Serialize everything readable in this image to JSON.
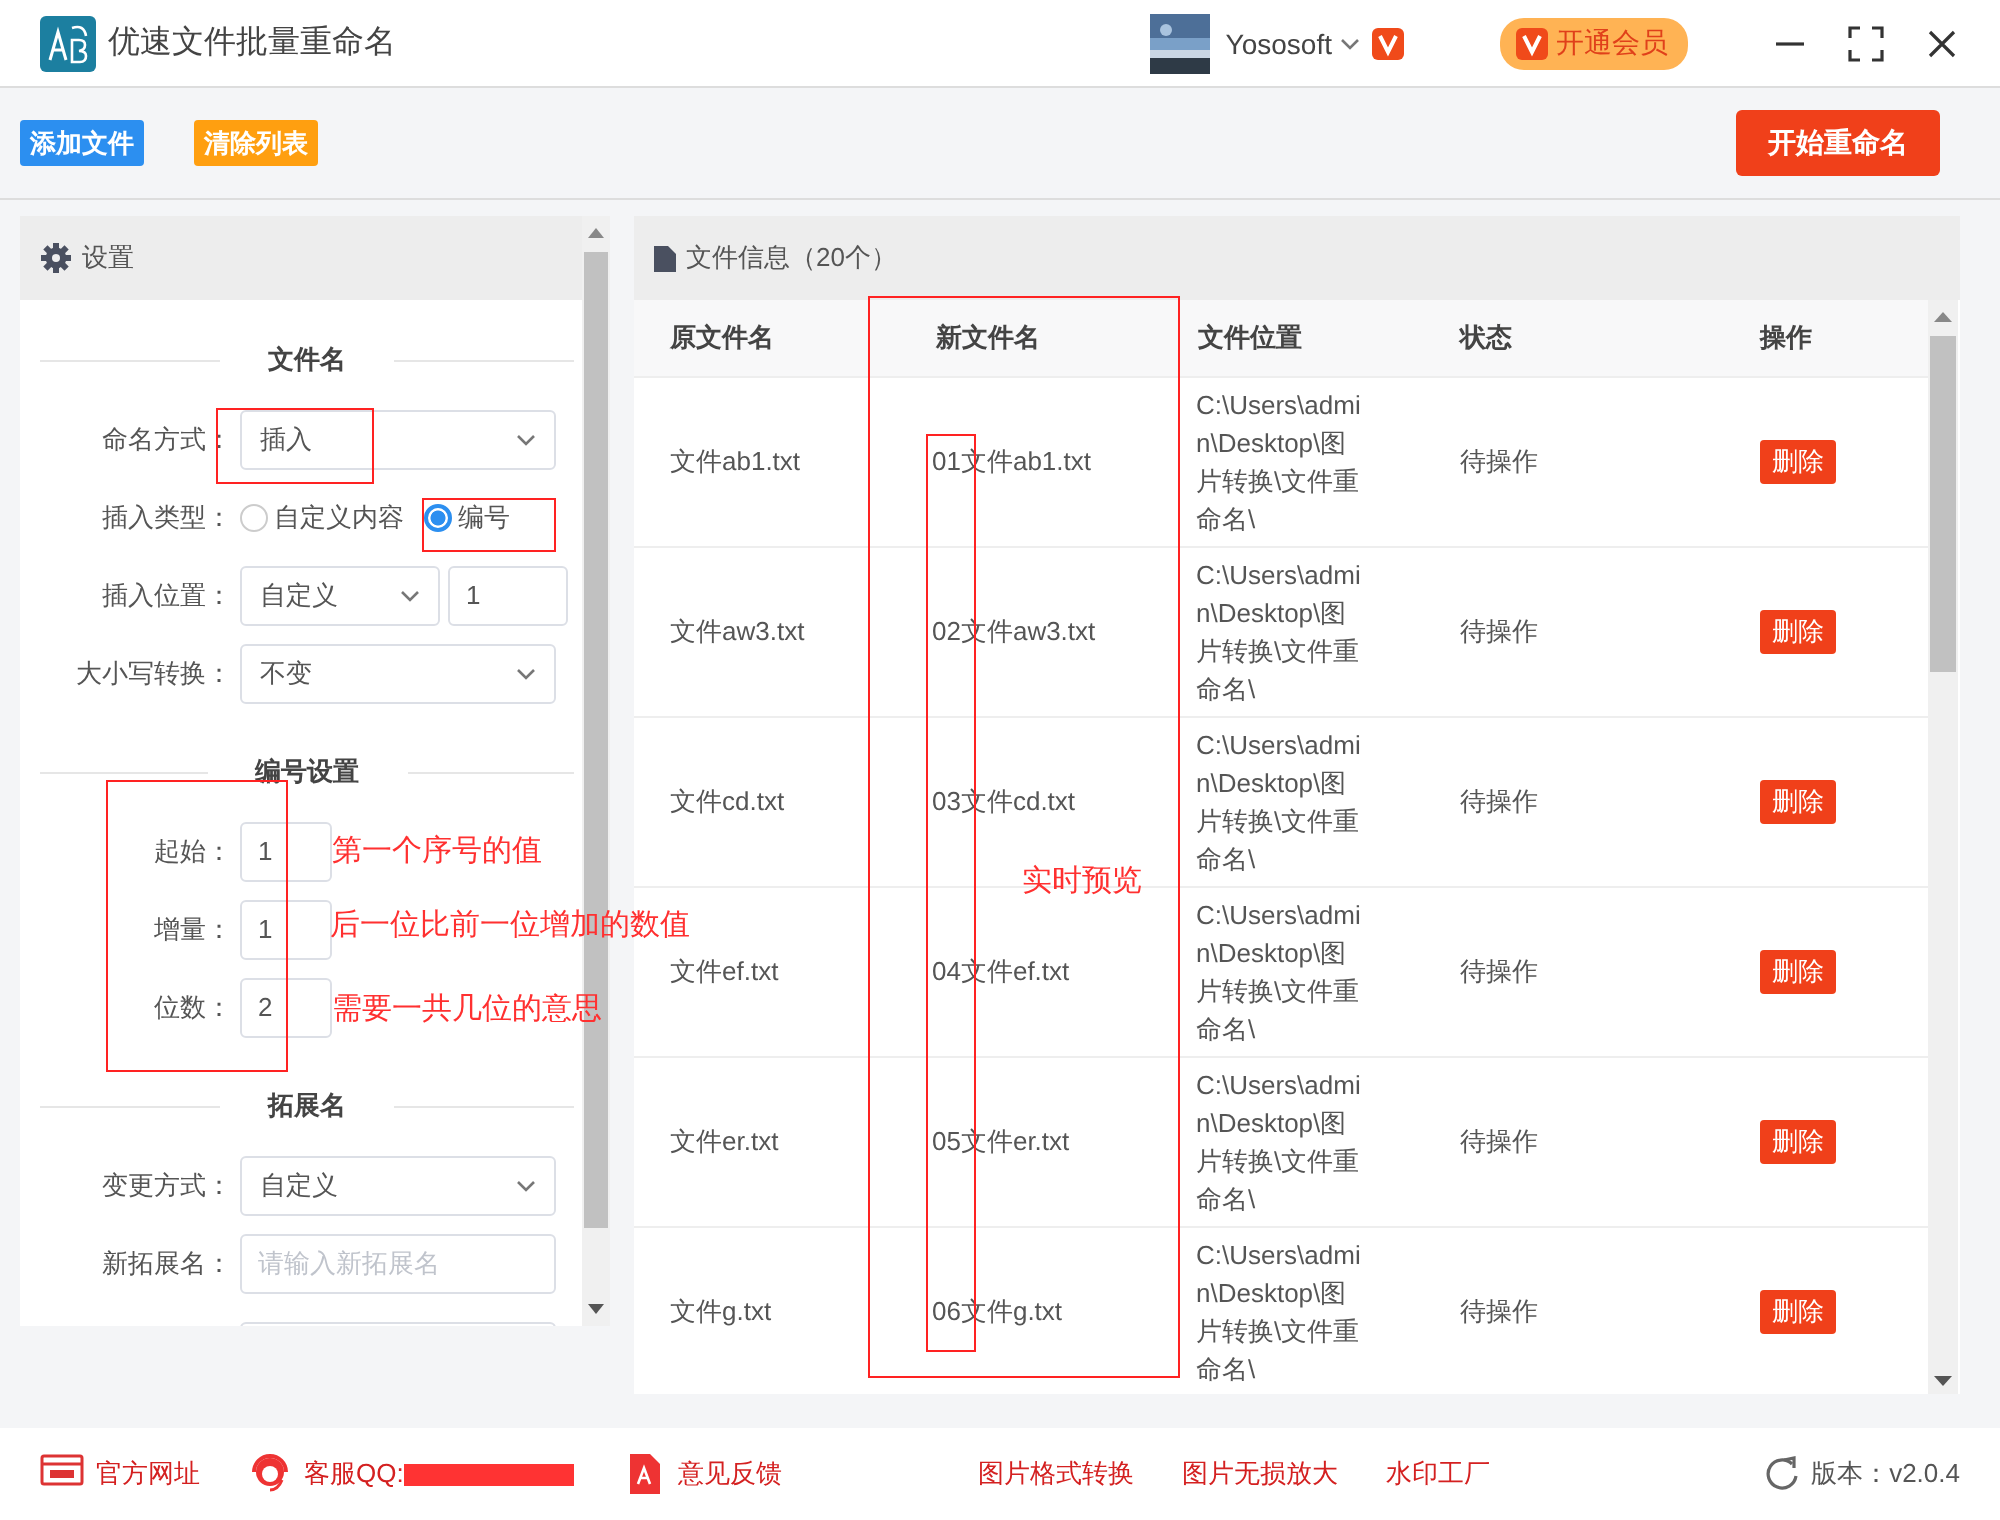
{
  "window": {
    "title": "优速文件批量重命名",
    "user": "Yososoft",
    "vip_button": "开通会员"
  },
  "toolbar": {
    "buttons": [
      {
        "label": "添加文件",
        "kind": "blue"
      },
      {
        "label": "清除列表",
        "kind": "orange"
      }
    ],
    "start_button": "开始重命名"
  },
  "settings": {
    "title": "设置",
    "sections": [
      {
        "title": "文件名",
        "rows": [
          {
            "kind": "select",
            "label": "命名方式：",
            "value": "插入"
          },
          {
            "kind": "radio",
            "label": "插入类型：",
            "options": [
              {
                "label": "自定义内容",
                "selected": false
              },
              {
                "label": "编号",
                "selected": true
              }
            ]
          },
          {
            "kind": "select-input",
            "label": "插入位置：",
            "value": "自定义",
            "input": "1"
          },
          {
            "kind": "select",
            "label": "大小写转换：",
            "value": "不变"
          }
        ]
      },
      {
        "title": "编号设置",
        "rows": [
          {
            "kind": "number",
            "label": "起始：",
            "value": "1"
          },
          {
            "kind": "number",
            "label": "增量：",
            "value": "1"
          },
          {
            "kind": "number",
            "label": "位数：",
            "value": "2"
          }
        ]
      },
      {
        "title": "拓展名",
        "rows": [
          {
            "kind": "select",
            "label": "变更方式：",
            "value": "自定义"
          },
          {
            "kind": "input",
            "label": "新拓展名：",
            "placeholder": "请输入新拓展名"
          }
        ]
      }
    ]
  },
  "files": {
    "title": "文件信息（20个）",
    "columns": [
      "原文件名",
      "新文件名",
      "文件位置",
      "状态",
      "操作"
    ],
    "rows": [
      {
        "original": "文件ab1.txt",
        "new": "01文件ab1.txt",
        "location": "C:\\Users\\admin\\Desktop\\图片转换\\文件重命名\\",
        "status": "待操作",
        "action": "删除"
      },
      {
        "original": "文件aw3.txt",
        "new": "02文件aw3.txt",
        "location": "C:\\Users\\admin\\Desktop\\图片转换\\文件重命名\\",
        "status": "待操作",
        "action": "删除"
      },
      {
        "original": "文件cd.txt",
        "new": "03文件cd.txt",
        "location": "C:\\Users\\admin\\Desktop\\图片转换\\文件重命名\\",
        "status": "待操作",
        "action": "删除"
      },
      {
        "original": "文件ef.txt",
        "new": "04文件ef.txt",
        "location": "C:\\Users\\admin\\Desktop\\图片转换\\文件重命名\\",
        "status": "待操作",
        "action": "删除"
      },
      {
        "original": "文件er.txt",
        "new": "05文件er.txt",
        "location": "C:\\Users\\admin\\Desktop\\图片转换\\文件重命名\\",
        "status": "待操作",
        "action": "删除"
      },
      {
        "original": "文件g.txt",
        "new": "06文件g.txt",
        "location": "C:\\Users\\admin\\Desktop\\图片转换\\文件重命名\\",
        "status": "待操作",
        "action": "删除"
      }
    ]
  },
  "annotations": [
    "第一个序号的值",
    "后一位比前一位增加的数值",
    "需要一共几位的意思",
    "实时预览"
  ],
  "footer": {
    "links": [
      {
        "kind": "web",
        "label": "官方网址"
      },
      {
        "kind": "support",
        "label": "客服QQ:"
      },
      {
        "kind": "feedback",
        "label": "意见反馈"
      }
    ],
    "tools": [
      "图片格式转换",
      "图片无损放大",
      "水印工厂"
    ],
    "version": "版本：v2.0.4"
  }
}
